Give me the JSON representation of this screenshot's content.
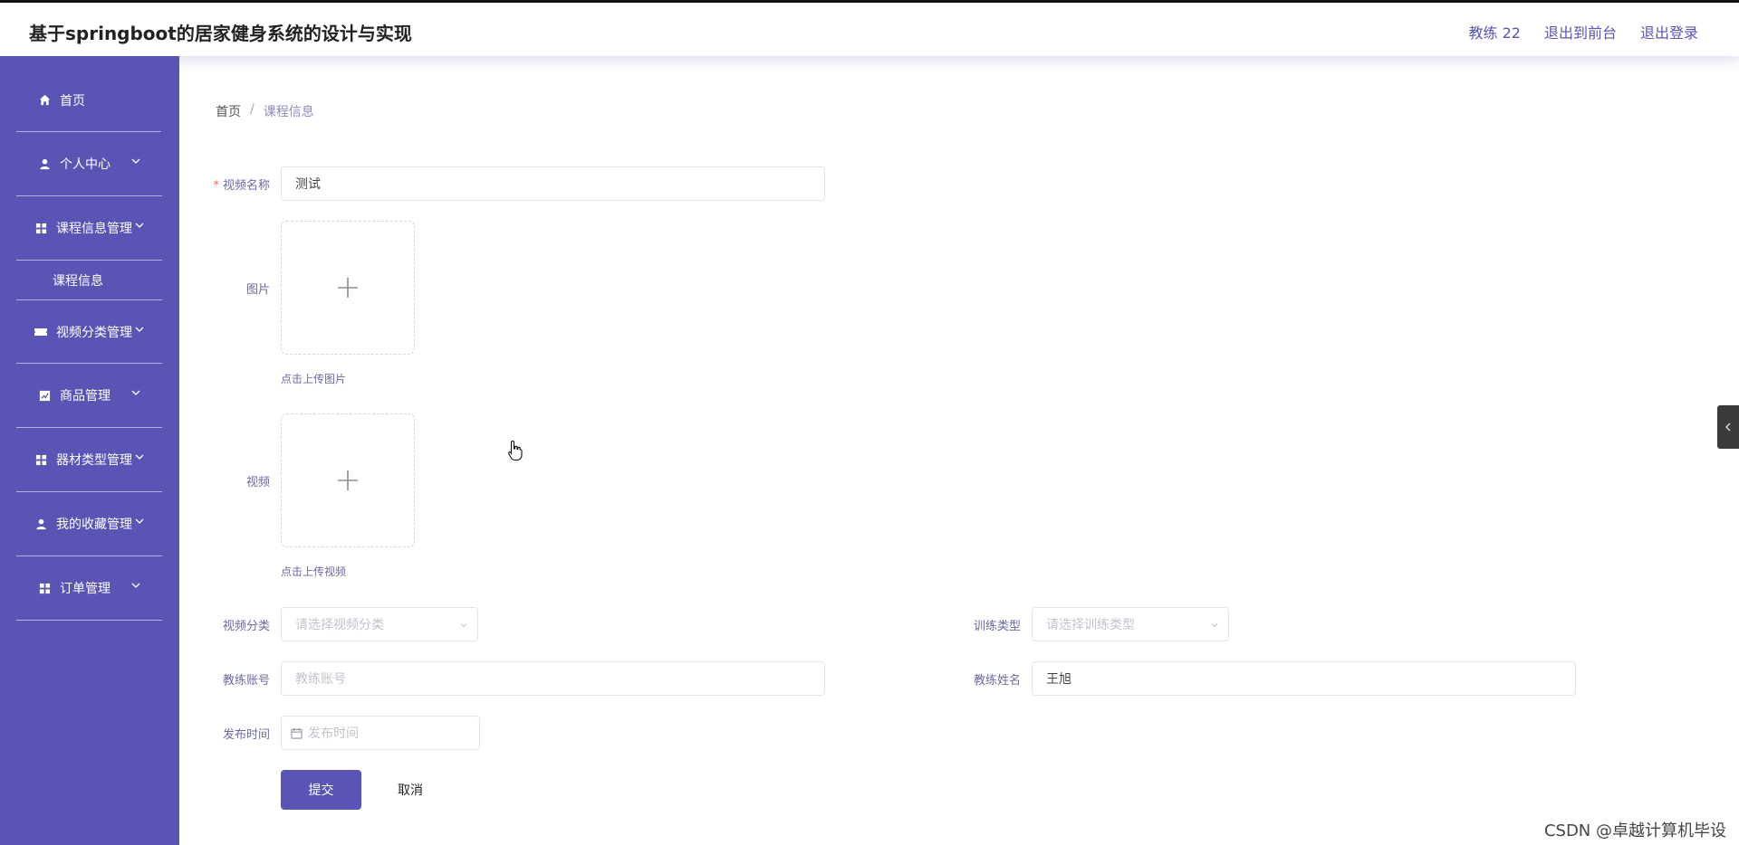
{
  "app": {
    "title": "基于springboot的居家健身系统的设计与实现"
  },
  "header": {
    "user": "教练 22",
    "to_front": "退出到前台",
    "logout": "退出登录"
  },
  "sidebar": {
    "items": [
      {
        "label": "首页",
        "icon": "home-icon"
      },
      {
        "label": "个人中心",
        "icon": "user-icon"
      },
      {
        "label": "课程信息管理",
        "icon": "grid-icon"
      },
      {
        "label": "视频分类管理",
        "icon": "ticket-icon"
      },
      {
        "label": "商品管理",
        "icon": "chart-icon"
      },
      {
        "label": "器材类型管理",
        "icon": "grid-icon"
      },
      {
        "label": "我的收藏管理",
        "icon": "user-icon"
      },
      {
        "label": "订单管理",
        "icon": "grid-icon"
      }
    ],
    "sub_item": "课程信息"
  },
  "breadcrumb": {
    "home": "首页",
    "sep": "/",
    "current": "课程信息"
  },
  "form": {
    "video_name_label": "视频名称",
    "video_name_value": "测试",
    "image_label": "图片",
    "image_hint": "点击上传图片",
    "video_label": "视频",
    "video_hint": "点击上传视频",
    "category_label": "视频分类",
    "category_placeholder": "请选择视频分类",
    "training_type_label": "训练类型",
    "training_type_placeholder": "请选择训练类型",
    "coach_account_label": "教练账号",
    "coach_account_placeholder": "教练账号",
    "coach_name_label": "教练姓名",
    "coach_name_value": "王旭",
    "publish_time_label": "发布时间",
    "publish_time_placeholder": "发布时间",
    "submit": "提交",
    "cancel": "取消"
  },
  "watermark": "CSDN @卓越计算机毕设",
  "colors": {
    "primary": "#5a55b5",
    "label": "#6b6aa0",
    "required": "#f56c6c"
  }
}
